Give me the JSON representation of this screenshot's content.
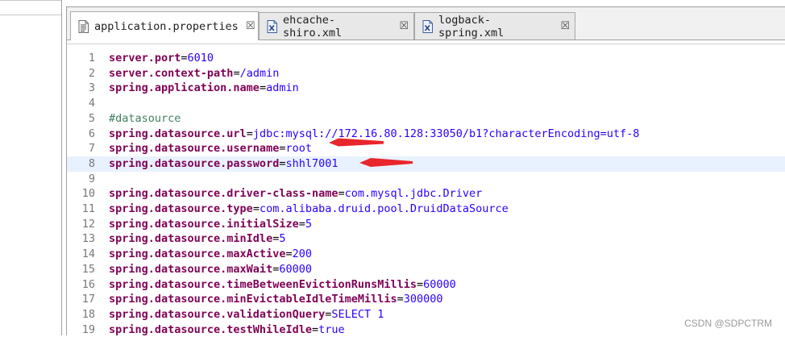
{
  "tabs": [
    {
      "label": "application.properties",
      "icon": "properties-file-icon",
      "active": true
    },
    {
      "label": "ehcache-shiro.xml",
      "icon": "xml-file-icon",
      "active": false
    },
    {
      "label": "logback-spring.xml",
      "icon": "xml-file-icon",
      "active": false
    }
  ],
  "close_glyph": "☒",
  "lines": [
    {
      "n": "1",
      "key": "server.port",
      "eq": "=",
      "value": "6010"
    },
    {
      "n": "2",
      "key": "server.context-path",
      "eq": "=",
      "value": "/admin"
    },
    {
      "n": "3",
      "key": "spring.application.name",
      "eq": "=",
      "value": "admin"
    },
    {
      "n": "4"
    },
    {
      "n": "5",
      "comment": "#datasource"
    },
    {
      "n": "6",
      "key": "spring.datasource.url",
      "eq": "=",
      "value": "jdbc:mysql://172.16.80.128:33050/b1?characterEncoding=utf-8"
    },
    {
      "n": "7",
      "key": "spring.datasource.username",
      "eq": "=",
      "value": "root"
    },
    {
      "n": "8",
      "key": "spring.datasource.password",
      "eq": "=",
      "value": "shhl7001",
      "current": true
    },
    {
      "n": "9"
    },
    {
      "n": "10",
      "key": "spring.datasource.driver-class-name",
      "eq": "=",
      "value": "com.mysql.jdbc.Driver"
    },
    {
      "n": "11",
      "key": "spring.datasource.type",
      "eq": "=",
      "value": "com.alibaba.druid.pool.DruidDataSource"
    },
    {
      "n": "12",
      "key": "spring.datasource.initialSize",
      "eq": "=",
      "value": "5"
    },
    {
      "n": "13",
      "key": "spring.datasource.minIdle",
      "eq": "=",
      "value": "5"
    },
    {
      "n": "14",
      "key": "spring.datasource.maxActive",
      "eq": "=",
      "value": "200"
    },
    {
      "n": "15",
      "key": "spring.datasource.maxWait",
      "eq": "=",
      "value": "60000"
    },
    {
      "n": "16",
      "key": "spring.datasource.timeBetweenEvictionRunsMillis",
      "eq": "=",
      "value": "60000"
    },
    {
      "n": "17",
      "key": "spring.datasource.minEvictableIdleTimeMillis",
      "eq": "=",
      "value": "300000"
    },
    {
      "n": "18",
      "key": "spring.datasource.validationQuery",
      "eq": "=",
      "value": "SELECT 1"
    },
    {
      "n": "19",
      "key": "spring.datasource.testWhileIdle",
      "eq": "=",
      "value": "true"
    }
  ],
  "watermark": "CSDN @SDPCTRM",
  "colors": {
    "key": "#7f0055",
    "value": "#2a00ff",
    "comment": "#3f7f5f",
    "current_line": "#e8f2fe",
    "annotation_arrow": "#e8262c"
  }
}
